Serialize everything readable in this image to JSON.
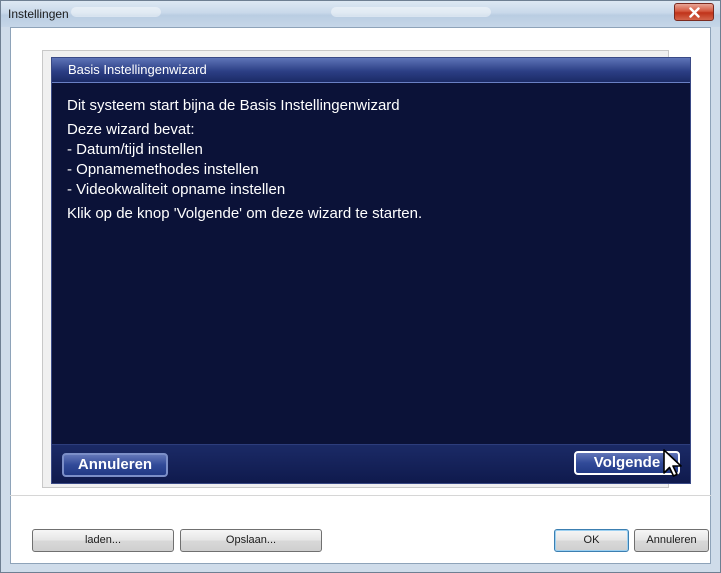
{
  "window": {
    "title": "Instellingen"
  },
  "wizard": {
    "header": "Basis Instellingenwizard",
    "lines": [
      "Dit systeem start bijna de Basis Instellingenwizard",
      "",
      "Deze wizard bevat:",
      "- Datum/tijd instellen",
      "- Opnamemethodes instellen",
      "- Videokwaliteit opname instellen",
      "",
      "Klik op de knop 'Volgende' om deze wizard te starten."
    ],
    "cancel_label": "Annuleren",
    "next_label": "Volgende"
  },
  "footer": {
    "load_label": "laden...",
    "save_label": "Opslaan...",
    "ok_label": "OK",
    "cancel_label": "Annuleren"
  },
  "colors": {
    "wizard_bg": "#0b1238",
    "wizard_header": "#2c3f85",
    "close_button": "#c0331a"
  },
  "icons": {
    "close": "close-icon",
    "cursor": "mouse-pointer-icon"
  }
}
